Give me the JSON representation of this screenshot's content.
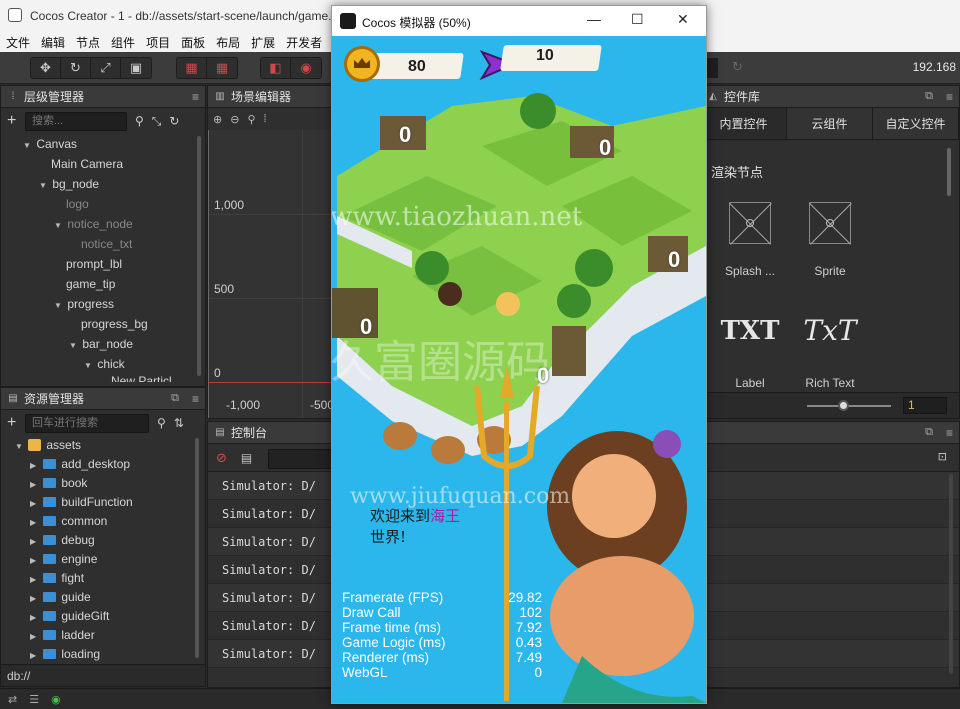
{
  "editor": {
    "window_title": "Cocos Creator - 1 - db://assets/start-scene/launch/game.",
    "menu": [
      "文件",
      "编辑",
      "节点",
      "组件",
      "项目",
      "面板",
      "布局",
      "扩展",
      "开发者"
    ],
    "ip": "192.168"
  },
  "hierarchy": {
    "title": "层级管理器",
    "search_placeholder": "搜索...",
    "nodes": [
      {
        "label": "Canvas",
        "arrow": "▼"
      },
      {
        "label": "Main Camera",
        "arrow": ""
      },
      {
        "label": "bg_node",
        "arrow": "▼"
      },
      {
        "label": "logo",
        "arrow": ""
      },
      {
        "label": "notice_node",
        "arrow": "▼"
      },
      {
        "label": "notice_txt",
        "arrow": ""
      },
      {
        "label": "prompt_lbl",
        "arrow": ""
      },
      {
        "label": "game_tip",
        "arrow": ""
      },
      {
        "label": "progress",
        "arrow": "▼"
      },
      {
        "label": "progress_bg",
        "arrow": ""
      },
      {
        "label": "bar_node",
        "arrow": "▼"
      },
      {
        "label": "chick",
        "arrow": "▼"
      },
      {
        "label": "New Particl",
        "arrow": ""
      }
    ]
  },
  "assets": {
    "title": "资源管理器",
    "search_placeholder": "回车进行搜索",
    "root": "assets",
    "folders": [
      "add_desktop",
      "book",
      "buildFunction",
      "common",
      "debug",
      "engine",
      "fight",
      "guide",
      "guideGift",
      "ladder",
      "loading"
    ],
    "footer": "db://"
  },
  "scene": {
    "title": "场景编辑器",
    "y_labels": [
      "1,000",
      "500",
      "0"
    ],
    "x_labels": [
      "-1,000",
      "-500"
    ]
  },
  "console": {
    "title": "控制台",
    "lines": [
      "Simulator: D/",
      "Simulator: D/",
      "Simulator: D/",
      "Simulator: D/",
      "Simulator: D/",
      "Simulator: D/",
      "Simulator: D/"
    ]
  },
  "widget_library": {
    "title": "控件库",
    "tabs": [
      "内置控件",
      "云组件",
      "自定义控件"
    ],
    "section": "渲染节点",
    "items": [
      {
        "label": "Splash ...",
        "icon": "splash-sprite-icon"
      },
      {
        "label": "Sprite",
        "icon": "sprite-icon"
      },
      {
        "label": "Label",
        "glyph": "TXT"
      },
      {
        "label": "Rich Text",
        "glyph": "TxT"
      }
    ],
    "zoom_value": "1"
  },
  "simulator": {
    "title": "Cocos 模拟器 (50%)",
    "coins": "80",
    "arrows": "10",
    "tile_counts": [
      "0",
      "0",
      "0",
      "0",
      "0"
    ],
    "welcome_line1": "欢迎来到",
    "welcome_highlight": "海王",
    "welcome_line2": "世界!",
    "watermark1": "www.tiaozhuan.net",
    "watermark2": "久富圈源码",
    "watermark3": "www.jiufuquan.com",
    "stats": [
      {
        "label": "Framerate (FPS)",
        "value": "29.82"
      },
      {
        "label": "Draw Call",
        "value": "102"
      },
      {
        "label": "Frame time (ms)",
        "value": "7.92"
      },
      {
        "label": "Game Logic (ms)",
        "value": "0.43"
      },
      {
        "label": "Renderer (ms)",
        "value": "7.49"
      },
      {
        "label": "WebGL",
        "value": "0"
      }
    ]
  }
}
